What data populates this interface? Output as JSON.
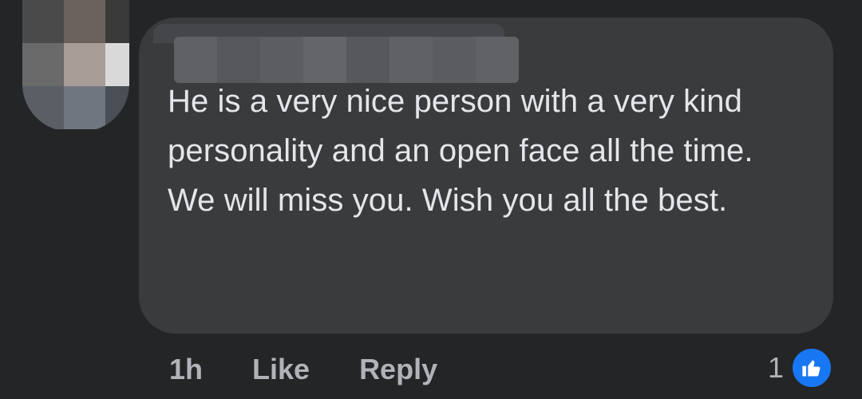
{
  "comment": {
    "text_lines": [
      "He is a very nice person with a very kind personality and an open face all the time.",
      "We will miss you. Wish you all the best."
    ]
  },
  "actions": {
    "timestamp": "1h",
    "like_label": "Like",
    "reply_label": "Reply"
  },
  "reactions": {
    "count": "1",
    "icon": "thumbs-up-icon",
    "icon_color": "#1877f2"
  },
  "colors": {
    "background": "#242526",
    "bubble": "#3a3b3c",
    "text": "#e4e6eb",
    "secondary_text": "#b0b3b8"
  }
}
